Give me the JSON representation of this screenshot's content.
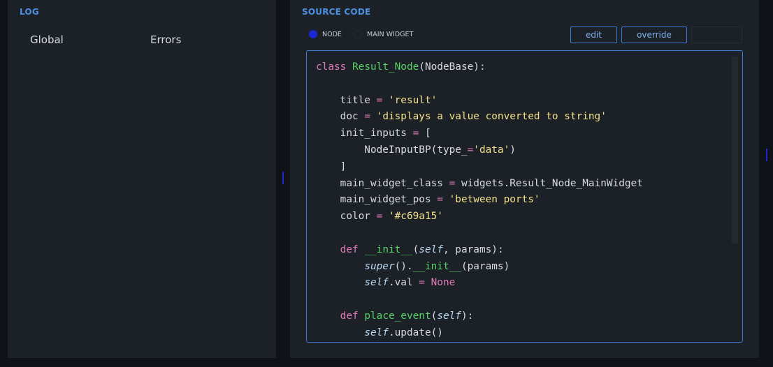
{
  "log": {
    "title": "LOG",
    "tabs": [
      {
        "label": "Global"
      },
      {
        "label": "Errors"
      }
    ]
  },
  "source": {
    "title": "SOURCE CODE",
    "radios": [
      {
        "label": "NODE",
        "selected": true
      },
      {
        "label": "MAIN WIDGET",
        "selected": false
      }
    ],
    "buttons": {
      "edit": "edit",
      "override": "override"
    },
    "code_lines": [
      "class Result_Node(NodeBase):",
      "",
      "    title = 'result'",
      "    doc = 'displays a value converted to string'",
      "    init_inputs = [",
      "        NodeInputBP(type_='data')",
      "    ]",
      "    main_widget_class = widgets.Result_Node_MainWidget",
      "    main_widget_pos = 'between ports'",
      "    color = '#c69a15'",
      "",
      "    def __init__(self, params):",
      "        super().__init__(params)",
      "        self.val = None",
      "",
      "    def place_event(self):",
      "        self.update()"
    ]
  },
  "colors": {
    "background": "#0f1216",
    "panel": "#1c2027",
    "accent": "#3d7fd6",
    "title": "#4a90e2",
    "radio_selected": "#1b27d6",
    "keyword": "#e07ab8",
    "class_name": "#56d364",
    "string": "#f2e08a"
  }
}
